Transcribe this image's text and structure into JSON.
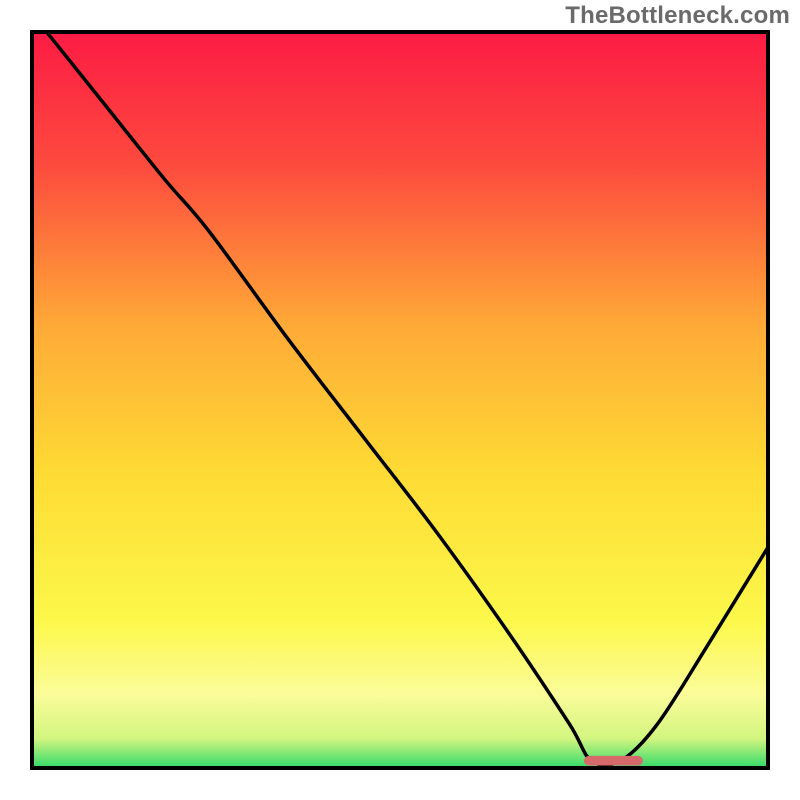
{
  "watermark": "TheBottleneck.com",
  "chart_data": {
    "type": "line",
    "title": "",
    "xlabel": "",
    "ylabel": "",
    "xlim": [
      0,
      100
    ],
    "ylim": [
      0,
      100
    ],
    "grid": false,
    "legend": false,
    "background_gradient": {
      "top_color": "#fc1b44",
      "mid_color": "#fedb34",
      "bottom_band_color": "#fbfc9a",
      "base_color": "#32da6b"
    },
    "series": [
      {
        "name": "bottleneck-curve",
        "color": "#000000",
        "x": [
          2,
          10,
          18,
          24,
          35,
          45,
          55,
          65,
          73,
          76,
          80,
          85,
          92,
          100
        ],
        "values": [
          100,
          90,
          80,
          73,
          58,
          45,
          32,
          18,
          6,
          1,
          1,
          6,
          17,
          30
        ]
      }
    ],
    "marker": {
      "name": "optimal-marker",
      "color": "#d66a6a",
      "x_start": 75,
      "x_end": 83,
      "y": 1,
      "height_pct": 1.3
    },
    "frame": {
      "stroke": "#000000",
      "stroke_width": 4
    }
  }
}
